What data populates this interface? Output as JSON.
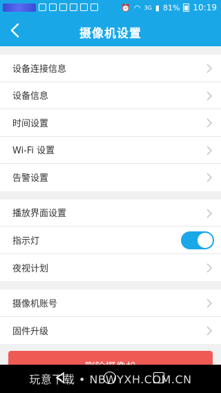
{
  "statusbar": {
    "signal_label": "3G",
    "battery_percent": "81%",
    "time": "10:19"
  },
  "header": {
    "title": "摄像机设置"
  },
  "groups": [
    {
      "items": [
        {
          "label": "设备连接信息"
        },
        {
          "label": "设备信息"
        },
        {
          "label": "时间设置"
        },
        {
          "label": "Wi-Fi 设置"
        },
        {
          "label": "告警设置"
        }
      ]
    },
    {
      "items": [
        {
          "label": "播放界面设置"
        },
        {
          "label": "指示灯",
          "toggle_on": true
        },
        {
          "label": "夜视计划"
        }
      ]
    },
    {
      "items": [
        {
          "label": "摄像机账号"
        },
        {
          "label": "固件升级"
        }
      ]
    }
  ],
  "delete_button": {
    "label": "删除摄像机"
  },
  "watermark": {
    "text": "玩意下载 • NBWYXH.COM.CN"
  },
  "colors": {
    "accent": "#1aa7e8",
    "danger": "#f05a55"
  }
}
